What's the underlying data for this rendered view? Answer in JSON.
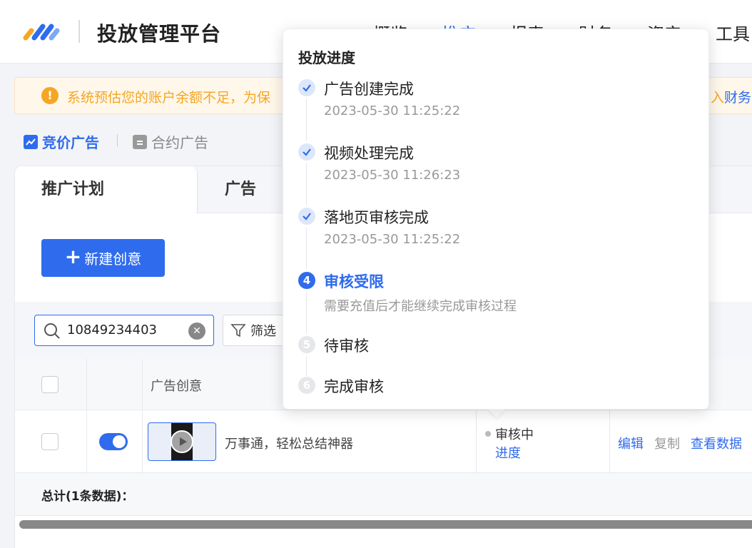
{
  "header": {
    "app_title": "投放管理平台",
    "nav": [
      "概览",
      "推广",
      "报表",
      "财务",
      "资产",
      "工具"
    ],
    "active_nav": "推广",
    "brand_colors": [
      "#2f6bed",
      "#f5a623"
    ]
  },
  "alert": {
    "text": "系统预估您的账户余额不足，为保",
    "right_text": "入",
    "right_link": "财务"
  },
  "ad_types": {
    "active": "竞价广告",
    "inactive": "合约广告"
  },
  "tabs": [
    "推广计划",
    "广告"
  ],
  "new_button": "新建创意",
  "search": {
    "value": "10849234403",
    "placeholder": ""
  },
  "filter_label": "筛选",
  "table": {
    "header_creative": "广告创意",
    "row": {
      "creative_name": "万事通，轻松总结神器",
      "status": "审核中",
      "progress_link": "进度",
      "actions": [
        "编辑",
        "复制",
        "查看数据"
      ]
    },
    "total": "总计(1条数据)："
  },
  "popover": {
    "title": "投放进度",
    "steps": [
      {
        "index": "1",
        "title": "广告创建完成",
        "time": "2023-05-30 11:25:22",
        "state": "done"
      },
      {
        "index": "2",
        "title": "视频处理完成",
        "time": "2023-05-30 11:26:23",
        "state": "done"
      },
      {
        "index": "3",
        "title": "落地页审核完成",
        "time": "2023-05-30 11:25:22",
        "state": "done"
      },
      {
        "index": "4",
        "title": "审核受限",
        "time": "需要充值后才能继续完成审核过程",
        "state": "current"
      },
      {
        "index": "5",
        "title": "待审核",
        "time": "",
        "state": "pending"
      },
      {
        "index": "6",
        "title": "完成审核",
        "time": "",
        "state": "pending"
      }
    ]
  }
}
